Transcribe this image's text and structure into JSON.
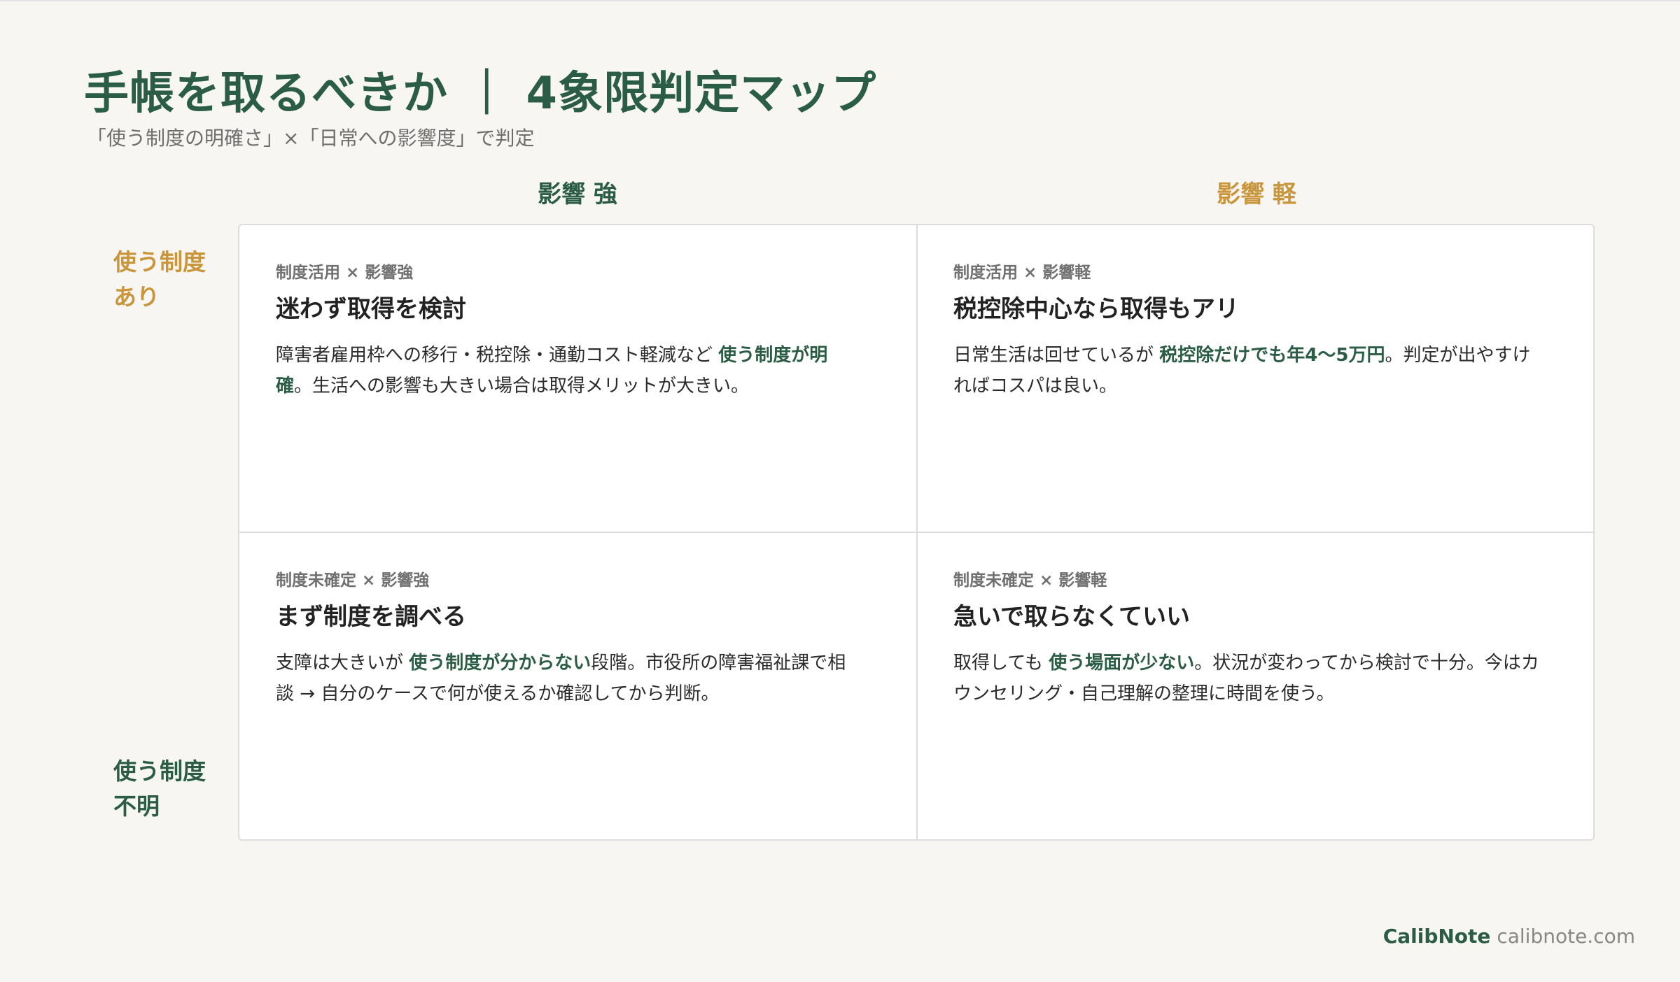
{
  "title": "手帳を取るべきか ｜ 4象限判定マップ",
  "subtitle": "「使う制度の明確さ」×「日常への影響度」で判定",
  "columns": {
    "strong": "影響 強",
    "light": "影響 軽"
  },
  "rows": {
    "yes": [
      "使う制度",
      "あり"
    ],
    "unknown": [
      "使う制度",
      "不明"
    ]
  },
  "quadrants": {
    "top_left": {
      "tag": "制度活用 × 影響強",
      "heading": "迷わず取得を検討",
      "body_pre": "障害者雇用枠への移行・税控除・通勤コスト軽減など ",
      "body_hl": "使う制度が明確",
      "body_post": "。生活への影響も大きい場合は取得メリットが大きい。"
    },
    "top_right": {
      "tag": "制度活用 × 影響軽",
      "heading": "税控除中心なら取得もアリ",
      "body_pre": "日常生活は回せているが ",
      "body_hl": "税控除だけでも年4〜5万円",
      "body_post": "。判定が出やすければコスパは良い。"
    },
    "bottom_left": {
      "tag": "制度未確定 × 影響強",
      "heading": "まず制度を調べる",
      "body_pre": "支障は大きいが ",
      "body_hl": "使う制度が分からない",
      "body_post": "段階。市役所の障害福祉課で相談 → 自分のケースで何が使えるか確認してから判断。"
    },
    "bottom_right": {
      "tag": "制度未確定 × 影響軽",
      "heading": "急いで取らなくていい",
      "body_pre": "取得しても ",
      "body_hl": "使う場面が少ない",
      "body_post": "。状況が変わってから検討で十分。今はカウンセリング・自己理解の整理に時間を使う。"
    }
  },
  "footer": {
    "brand": "CalibNote",
    "domain": "calibnote.com"
  },
  "colors": {
    "primary_green": "#2b5c46",
    "accent_gold": "#c9963b",
    "background": "#f7f6f3"
  }
}
